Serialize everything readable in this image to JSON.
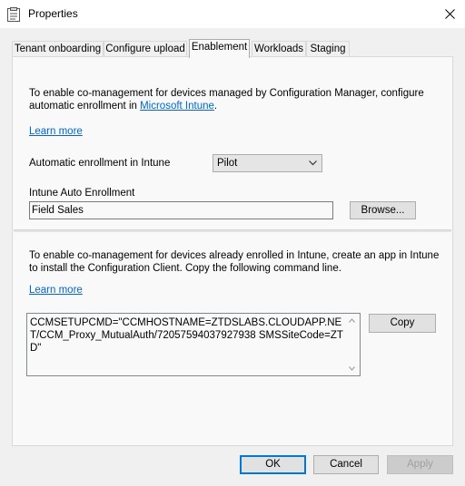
{
  "window": {
    "title": "Properties"
  },
  "tabs": [
    {
      "label": "Tenant onboarding",
      "active": false
    },
    {
      "label": "Configure upload",
      "active": false
    },
    {
      "label": "Enablement",
      "active": true
    },
    {
      "label": "Workloads",
      "active": false
    },
    {
      "label": "Staging",
      "active": false
    }
  ],
  "section1": {
    "intro_line1": "To enable co-management for devices managed by Configuration Manager, configure",
    "intro_line2_prefix": "automatic enrollment in ",
    "intro_link": "Microsoft Intune",
    "intro_suffix": ".",
    "learn_more": "Learn more",
    "auto_enroll_label": "Automatic enrollment in Intune",
    "auto_enroll_value": "Pilot",
    "auto_enrollment_label": "Intune Auto Enrollment",
    "auto_enrollment_value": "Field Sales",
    "browse_button": "Browse..."
  },
  "section2": {
    "intro_line1": "To enable co-management for devices already enrolled in Intune, create an app in Intune",
    "intro_line2": "to install the Configuration Client. Copy the following command line.",
    "learn_more": "Learn more",
    "command_line": "CCMSETUPCMD=\"CCMHOSTNAME=ZTDSLABS.CLOUDAPP.NET/CCM_Proxy_MutualAuth/72057594037927938 SMSSiteCode=ZTD\"",
    "copy_button": "Copy"
  },
  "footer": {
    "ok": "OK",
    "cancel": "Cancel",
    "apply": "Apply"
  },
  "colors": {
    "accent": "#0078d7",
    "link": "#0066cc",
    "panel": "#f9f9f9",
    "chrome": "#f0f0f0"
  },
  "icons": {
    "app": "properties-window-icon",
    "close": "close-icon",
    "combo": "chevron-down-icon",
    "scroll_up": "scroll-up-arrow-icon",
    "scroll_down": "scroll-down-arrow-icon"
  }
}
